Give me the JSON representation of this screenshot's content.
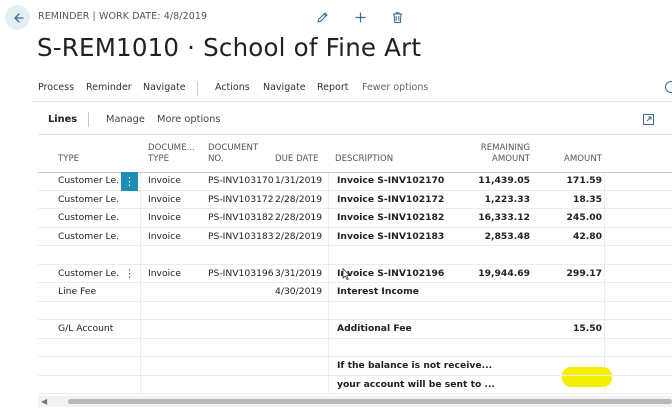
{
  "header": {
    "caption": "REMINDER | WORK DATE: 4/8/2019",
    "title": "S-REM1010 · School of Fine Art",
    "icons": [
      "back-arrow-icon",
      "edit-pencil-icon",
      "add-plus-icon",
      "delete-trash-icon"
    ]
  },
  "actions": {
    "process": "Process",
    "reminder": "Reminder",
    "navigate1": "Navigate",
    "actions": "Actions",
    "navigate2": "Navigate",
    "report": "Report",
    "fewer": "Fewer options"
  },
  "lines": {
    "title": "Lines",
    "manage": "Manage",
    "more": "More options"
  },
  "columns": {
    "type": "TYPE",
    "doc_type_1": "DOCUME...",
    "doc_type_2": "TYPE",
    "doc_no_1": "DOCUMENT",
    "doc_no_2": "NO.",
    "due_date": "DUE DATE",
    "description": "DESCRIPTION",
    "remaining_1": "REMAINING",
    "remaining_2": "AMOUNT",
    "amount": "AMOUNT"
  },
  "rows": [
    {
      "type": "Customer Le...",
      "doc_type": "Invoice",
      "doc_no": "PS-INV103170",
      "due_date": "1/31/2019",
      "description": "Invoice S-INV102170",
      "remaining": "11,439.05",
      "amount": "171.59"
    },
    {
      "type": "Customer Le...",
      "doc_type": "Invoice",
      "doc_no": "PS-INV103172",
      "due_date": "2/28/2019",
      "description": "Invoice S-INV102172",
      "remaining": "1,223.33",
      "amount": "18.35"
    },
    {
      "type": "Customer Le...",
      "doc_type": "Invoice",
      "doc_no": "PS-INV103182",
      "due_date": "2/28/2019",
      "description": "Invoice S-INV102182",
      "remaining": "16,333.12",
      "amount": "245.00"
    },
    {
      "type": "Customer Le...",
      "doc_type": "Invoice",
      "doc_no": "PS-INV103183",
      "due_date": "2/28/2019",
      "description": "Invoice S-INV102183",
      "remaining": "2,853.48",
      "amount": "42.80"
    },
    {
      "type": "",
      "doc_type": "",
      "doc_no": "",
      "due_date": "",
      "description": "",
      "remaining": "",
      "amount": ""
    },
    {
      "type": "Customer Le...",
      "doc_type": "Invoice",
      "doc_no": "PS-INV103196",
      "due_date": "3/31/2019",
      "description": "Invoice S-INV102196",
      "remaining": "19,944.69",
      "amount": "299.17"
    },
    {
      "type": "Line Fee",
      "doc_type": "",
      "doc_no": "",
      "due_date": "4/30/2019",
      "description": "Interest Income",
      "remaining": "",
      "amount": ""
    },
    {
      "type": "",
      "doc_type": "",
      "doc_no": "",
      "due_date": "",
      "description": "",
      "remaining": "",
      "amount": ""
    },
    {
      "type": "G/L Account",
      "doc_type": "",
      "doc_no": "",
      "due_date": "",
      "description": "Additional Fee",
      "remaining": "",
      "amount": "15.50"
    },
    {
      "type": "",
      "doc_type": "",
      "doc_no": "",
      "due_date": "",
      "description": "",
      "remaining": "",
      "amount": ""
    },
    {
      "type": "",
      "doc_type": "",
      "doc_no": "",
      "due_date": "",
      "description": "If the balance is not receive...",
      "remaining": "",
      "amount": ""
    },
    {
      "type": "",
      "doc_type": "",
      "doc_no": "",
      "due_date": "",
      "description": "your account will be sent to ...",
      "remaining": "",
      "amount": ""
    }
  ],
  "colors": {
    "accent": "#1d8fb5",
    "highlight": "#f4ef00"
  }
}
